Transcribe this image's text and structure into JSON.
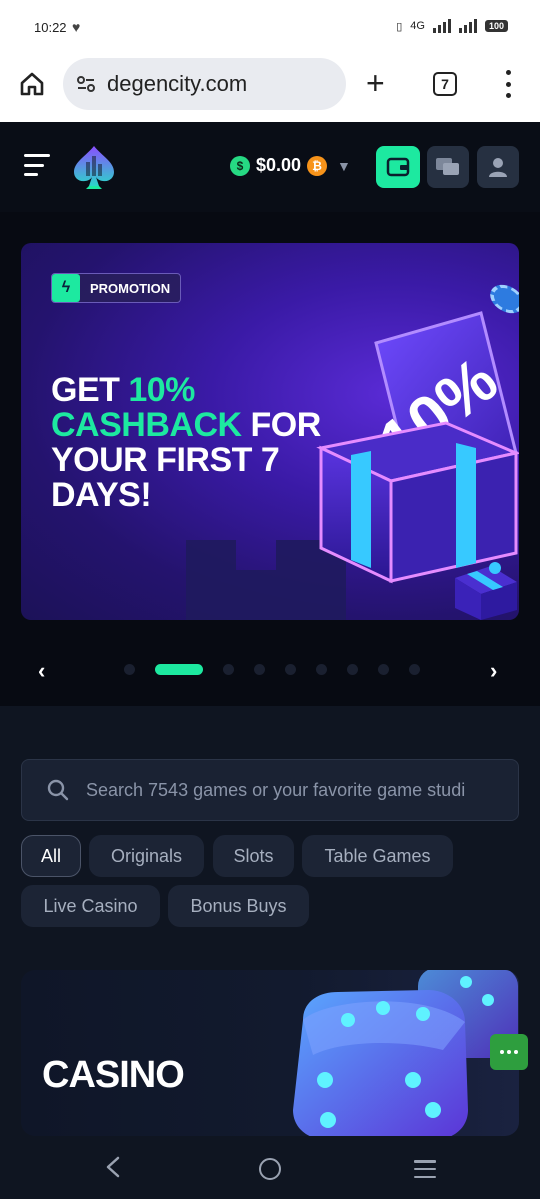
{
  "status_bar": {
    "time": "10:22",
    "network": "4G",
    "battery": "100"
  },
  "browser": {
    "url": "degencity.com",
    "tab_count": "7"
  },
  "header": {
    "balance": "$0.00",
    "currency_icon": "dollar-coin-icon",
    "crypto_icon": "bitcoin-icon"
  },
  "banner": {
    "tag": "PROMOTION",
    "headline_part1": "GET ",
    "headline_highlight": "10% CASHBACK",
    "headline_part2": " FOR YOUR FIRST 7 DAYS!",
    "badge_text": "10%",
    "slides_total": 10,
    "active_slide": 2
  },
  "search": {
    "placeholder": "Search 7543 games or your favorite game studi"
  },
  "categories": [
    "All",
    "Originals",
    "Slots",
    "Table Games",
    "Live Casino",
    "Bonus Buys"
  ],
  "active_category": "All",
  "casino_card": {
    "title": "CASINO"
  },
  "colors": {
    "accent": "#1de9a0",
    "background": "#0f1521",
    "header": "#090d16",
    "chip": "#1c2435"
  }
}
